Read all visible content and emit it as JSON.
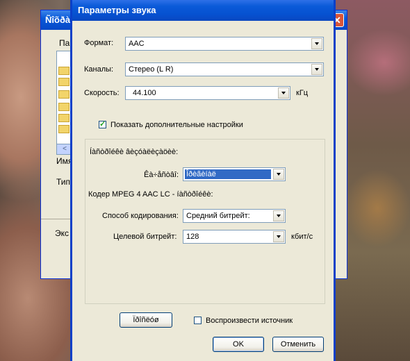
{
  "parent_window": {
    "title": "Ñîõðà",
    "close": "✕",
    "label_top": "Папк",
    "label_name": "Имя",
    "label_type": "Тип",
    "label_export": "Экс",
    "scroll_left": "<"
  },
  "dialog": {
    "title": "Параметры звука",
    "format": {
      "label": "Формат:",
      "value": "AAC"
    },
    "channels": {
      "label": "Каналы:",
      "value": "Стерео (L R)"
    },
    "rate": {
      "label": "Скорость:",
      "value": "44.100",
      "unit": "кГц"
    },
    "show_advanced": {
      "label": "Показать дополнительные настройки",
      "checked": true
    },
    "advanced_group": {
      "heading": "Íàñòðîéêè âèçóàëèçàöèè:",
      "quality": {
        "label": "Êà÷åñòâî:",
        "value": "Îðèãèíàë"
      },
      "encoder_heading": "Кодер MPEG 4 AAC LC - íàñòðîéêè:",
      "encoding_method": {
        "label": "Способ кодирования:",
        "value": "Средний битрейт:"
      },
      "target_bitrate": {
        "label": "Целевой битрейт:",
        "value": "128",
        "unit": "кбит/с"
      }
    },
    "reset_button": "Ïðîñëóø",
    "play_source": {
      "label": "Воспроизвести источник",
      "checked": false
    },
    "ok_button": "OK",
    "cancel_button": "Отменить"
  },
  "colors": {
    "titlebar": "#0a5ad8",
    "selection": "#316ac5",
    "dialog_bg": "#ece9d8"
  }
}
